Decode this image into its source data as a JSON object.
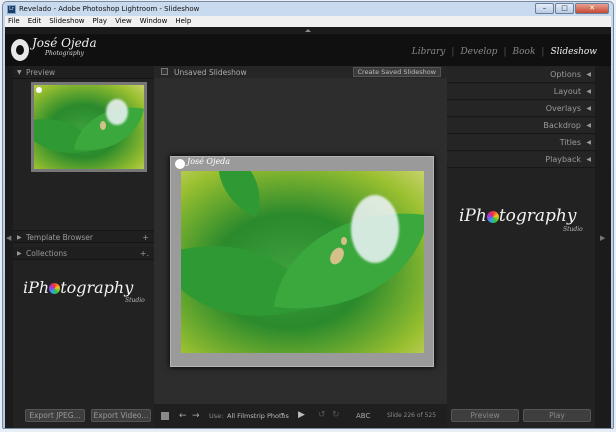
{
  "window": {
    "title": "Revelado - Adobe Photoshop Lightroom - Slideshow"
  },
  "menu": [
    "File",
    "Edit",
    "Slideshow",
    "Play",
    "View",
    "Window",
    "Help"
  ],
  "identity": {
    "name": "José Ojeda",
    "tagline": "Photography"
  },
  "modules": [
    "Library",
    "Develop",
    "Book",
    "Slideshow"
  ],
  "active_module": "Slideshow",
  "left_panel": {
    "preview_label": "Preview",
    "template_browser_label": "Template Browser",
    "collections_label": "Collections",
    "export_jpeg_label": "Export JPEG...",
    "export_video_label": "Export Video..."
  },
  "center": {
    "collection_label": "Unsaved Slideshow",
    "create_saved_label": "Create Saved Slideshow",
    "use_label": "Use:",
    "use_value": "All Filmstrip Photos",
    "abc_label": "ABC",
    "slide_counter": "Slide 226 of 525"
  },
  "right_panel": {
    "sections": [
      "Options",
      "Layout",
      "Overlays",
      "Backdrop",
      "Titles",
      "Playback"
    ],
    "preview_btn": "Preview",
    "play_btn": "Play"
  },
  "brand": {
    "prefix": "iPh",
    "suffix": "tography",
    "sub": "Studio"
  }
}
